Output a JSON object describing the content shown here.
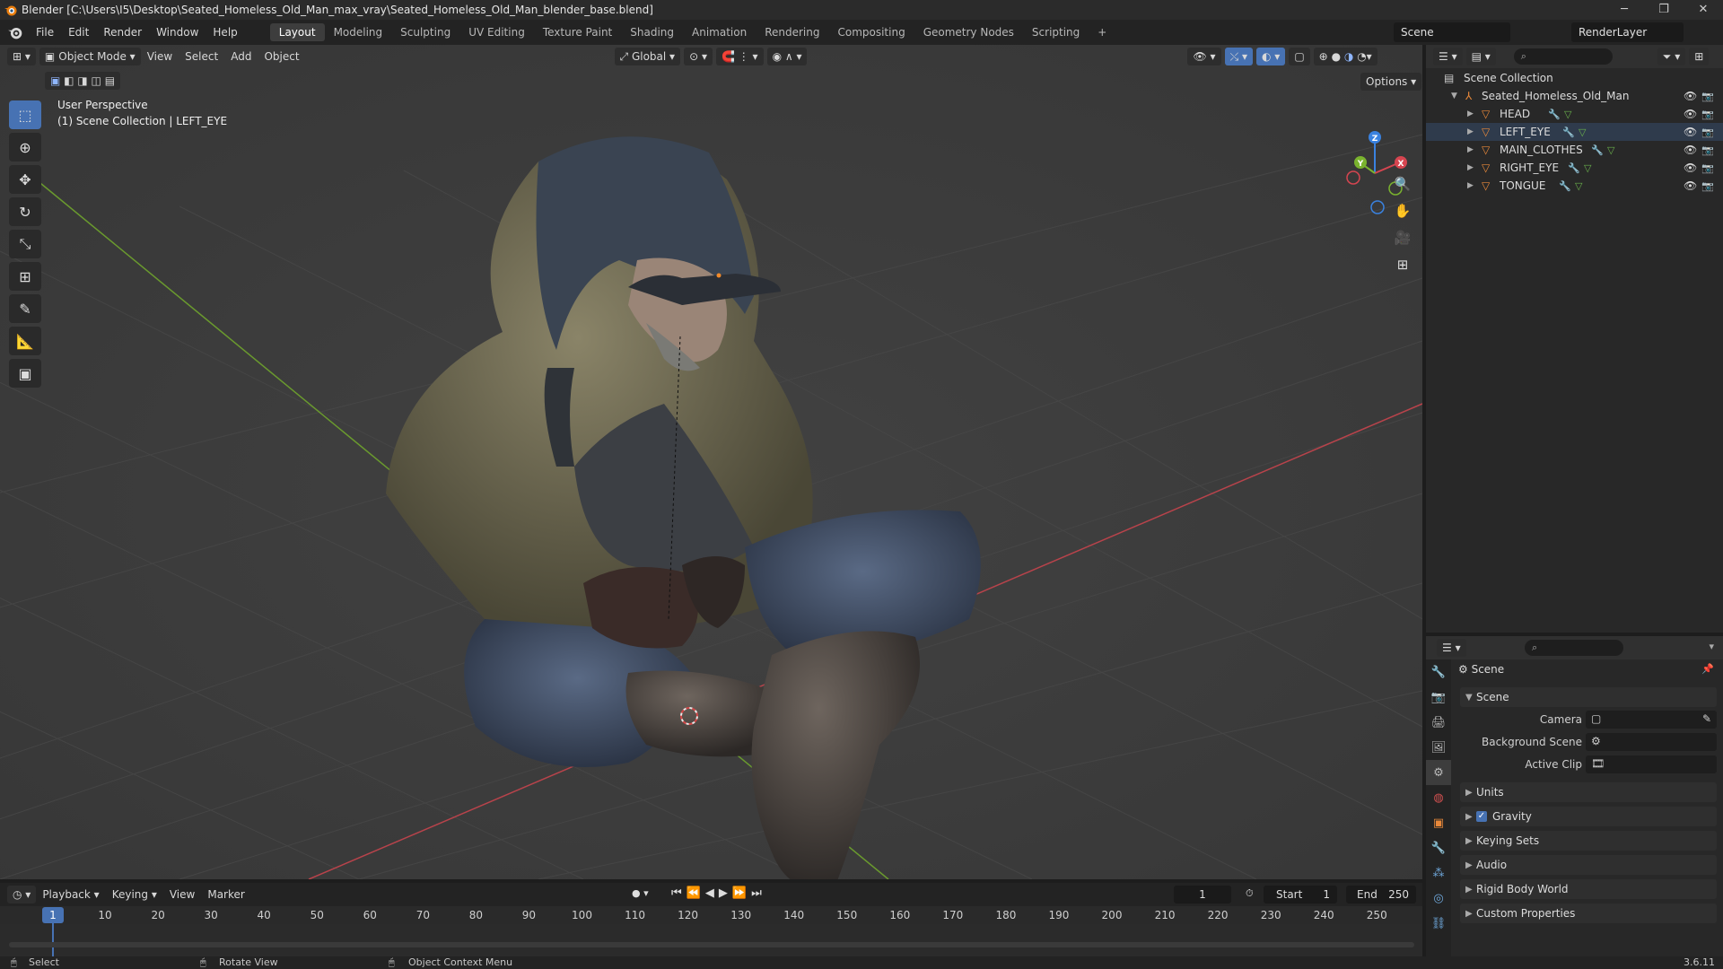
{
  "window": {
    "title": "Blender [C:\\Users\\I5\\Desktop\\Seated_Homeless_Old_Man_max_vray\\Seated_Homeless_Old_Man_blender_base.blend]",
    "minimize": "─",
    "maximize": "❐",
    "close": "✕"
  },
  "menubar": {
    "menus": [
      "File",
      "Edit",
      "Render",
      "Window",
      "Help"
    ],
    "workspaces": [
      "Layout",
      "Modeling",
      "Sculpting",
      "UV Editing",
      "Texture Paint",
      "Shading",
      "Animation",
      "Rendering",
      "Compositing",
      "Geometry Nodes",
      "Scripting"
    ],
    "active_workspace": "Layout",
    "add_workspace": "+",
    "scene_name": "Scene",
    "view_layer": "RenderLayer"
  },
  "viewport": {
    "mode": "Object Mode",
    "menus": [
      "View",
      "Select",
      "Add",
      "Object"
    ],
    "orientation": "Global",
    "options_label": "Options",
    "overlay_line1": "User Perspective",
    "overlay_line2": "(1) Scene Collection | LEFT_EYE",
    "gizmo_axes": {
      "x": "X",
      "y": "Y",
      "z": "Z"
    }
  },
  "outliner": {
    "root": "Scene Collection",
    "collection": "Seated_Homeless_Old_Man",
    "objects": [
      "HEAD",
      "LEFT_EYE",
      "MAIN_CLOTHES",
      "RIGHT_EYE",
      "TONGUE"
    ]
  },
  "properties": {
    "context_title": "Scene",
    "panel_scene": "Scene",
    "camera_label": "Camera",
    "background_scene_label": "Background Scene",
    "active_clip_label": "Active Clip",
    "sections": [
      "Units",
      "Gravity",
      "Keying Sets",
      "Audio",
      "Rigid Body World",
      "Custom Properties"
    ],
    "gravity_enabled": true
  },
  "timeline": {
    "menus": [
      "Playback",
      "Keying",
      "View",
      "Marker"
    ],
    "current_frame": "1",
    "start_label": "Start",
    "start_value": "1",
    "end_label": "End",
    "end_value": "250",
    "ruler_current": "1",
    "ruler_ticks": [
      "10",
      "20",
      "30",
      "40",
      "50",
      "60",
      "70",
      "80",
      "90",
      "100",
      "110",
      "120",
      "130",
      "140",
      "150",
      "160",
      "170",
      "180",
      "190",
      "200",
      "210",
      "220",
      "230",
      "240",
      "250"
    ]
  },
  "statusbar": {
    "select": "Select",
    "rotate_view": "Rotate View",
    "context_menu": "Object Context Menu",
    "version": "3.6.11"
  },
  "colors": {
    "accent": "#4772b3",
    "orange_object": "#e8883a",
    "x_axis": "#d64550",
    "y_axis": "#7ab32e",
    "z_axis": "#3a82e0"
  }
}
